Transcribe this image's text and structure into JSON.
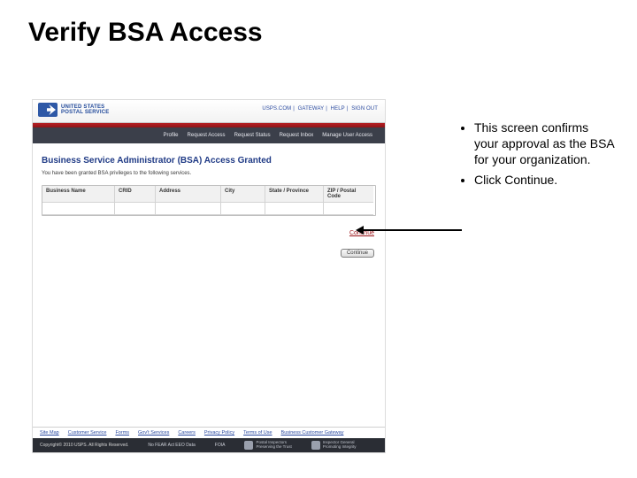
{
  "slide": {
    "title": "Verify BSA Access"
  },
  "bullets": {
    "items": [
      "This screen confirms your approval as the BSA for your organization.",
      "Click Continue."
    ]
  },
  "screenshot": {
    "logo_text": "UNITED STATES\nPOSTAL SERVICE",
    "top_right_links": [
      "USPS.COM",
      "GATEWAY",
      "HELP",
      "SIGN OUT"
    ],
    "tabs": [
      "Profile",
      "Request Access",
      "Request Status",
      "Request Inbox",
      "Manage User Access"
    ],
    "section_title": "Business Service Administrator (BSA) Access Granted",
    "subtext": "You have been granted BSA privileges to the following services.",
    "columns": [
      "Business Name",
      "CRID",
      "Address",
      "City",
      "State / Province",
      "ZIP / Postal Code"
    ],
    "continue_label": "Continue",
    "button_label": "Continue",
    "footer_links": [
      "Site Map",
      "Customer Service",
      "Forms",
      "Gov't Services",
      "Careers",
      "Privacy Policy",
      "Terms of Use",
      "Business Customer Gateway"
    ],
    "copyright": "Copyright© 2010 USPS. All Rights Reserved.",
    "chips": [
      "No FEAR Act EEO Data",
      "FOIA"
    ],
    "badges": [
      "Postal Inspectors\nPreserving the Trust",
      "Inspector General\nPromoting Integrity"
    ]
  }
}
